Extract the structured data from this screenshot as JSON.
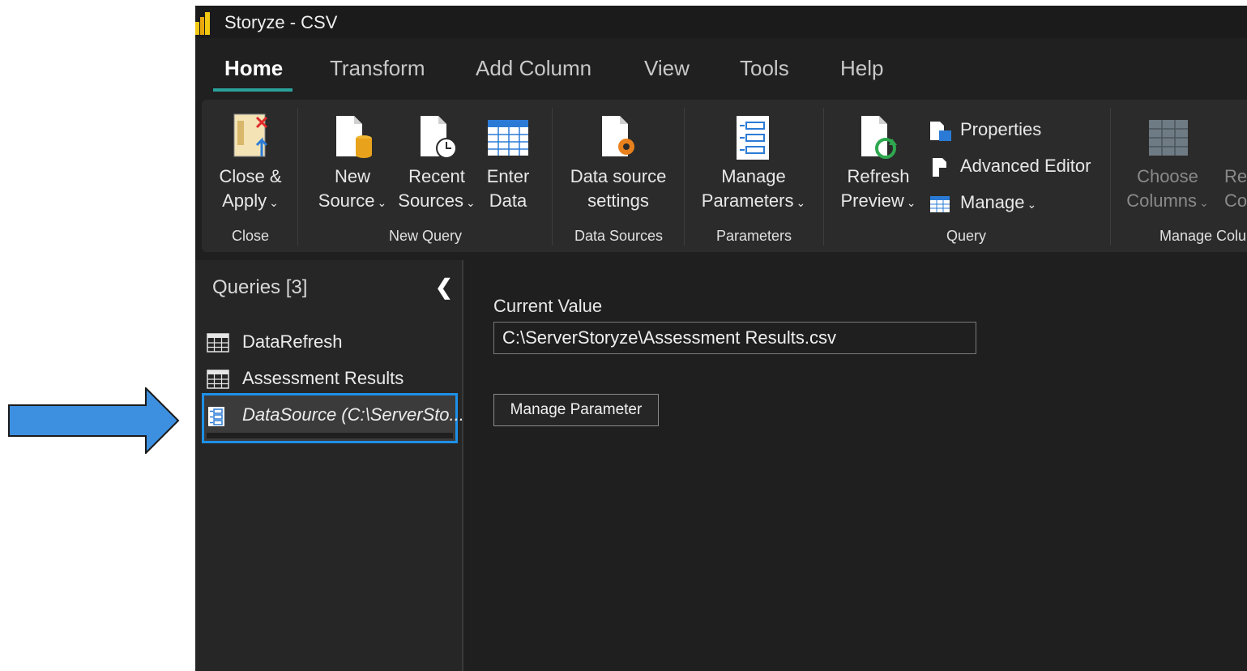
{
  "window": {
    "title": "Storyze - CSV"
  },
  "tabs": [
    "Home",
    "Transform",
    "Add Column",
    "View",
    "Tools",
    "Help"
  ],
  "ribbon": {
    "close_apply": [
      "Close &",
      "Apply"
    ],
    "new_source": [
      "New",
      "Source"
    ],
    "recent_sources": [
      "Recent",
      "Sources"
    ],
    "enter_data": [
      "Enter",
      "Data"
    ],
    "data_source_settings": [
      "Data source",
      "settings"
    ],
    "manage_parameters": [
      "Manage",
      "Parameters"
    ],
    "refresh_preview": [
      "Refresh",
      "Preview"
    ],
    "properties": "Properties",
    "advanced_editor": "Advanced Editor",
    "manage": "Manage",
    "choose_columns": [
      "Choose",
      "Columns"
    ],
    "remove_columns_partial": [
      "Re",
      "Co"
    ],
    "groups": {
      "close": "Close",
      "new_query": "New Query",
      "data_sources": "Data Sources",
      "parameters": "Parameters",
      "query": "Query",
      "manage_columns": "Manage Colu"
    }
  },
  "queries": {
    "title": "Queries [3]",
    "items": [
      {
        "label": "DataRefresh",
        "icon": "table-icon"
      },
      {
        "label": "Assessment Results",
        "icon": "table-icon"
      },
      {
        "label": "DataSource (C:\\ServerSto...",
        "icon": "parameter-icon"
      }
    ]
  },
  "parameter": {
    "current_value_label": "Current Value",
    "current_value": "C:\\ServerStoryze\\Assessment Results.csv",
    "manage_button": "Manage Parameter"
  },
  "colors": {
    "accent": "#2aa19a",
    "selection_border": "#1e90e8",
    "arrow": "#3d8fe0"
  }
}
